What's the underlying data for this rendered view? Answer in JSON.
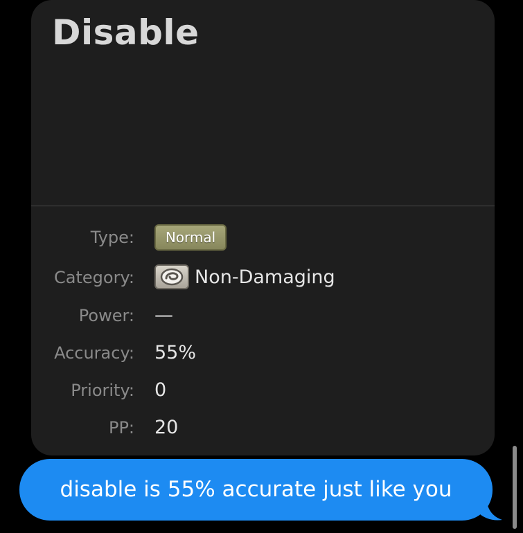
{
  "card": {
    "title": "Disable",
    "rows": {
      "type": {
        "label": "Type:",
        "value": "Normal"
      },
      "category": {
        "label": "Category:",
        "value": "Non-Damaging",
        "icon": "non-damaging-icon"
      },
      "power": {
        "label": "Power:",
        "value": "—"
      },
      "accuracy": {
        "label": "Accuracy:",
        "value": "55%"
      },
      "priority": {
        "label": "Priority:",
        "value": "0"
      },
      "pp": {
        "label": "PP:",
        "value": "20"
      }
    }
  },
  "message": {
    "text": "disable is 55% accurate just like you",
    "bubble_color": "#1d8bf2"
  },
  "colors": {
    "background": "#000000",
    "card_background": "#1e1e1e",
    "type_badge": "#9a9a6e"
  }
}
